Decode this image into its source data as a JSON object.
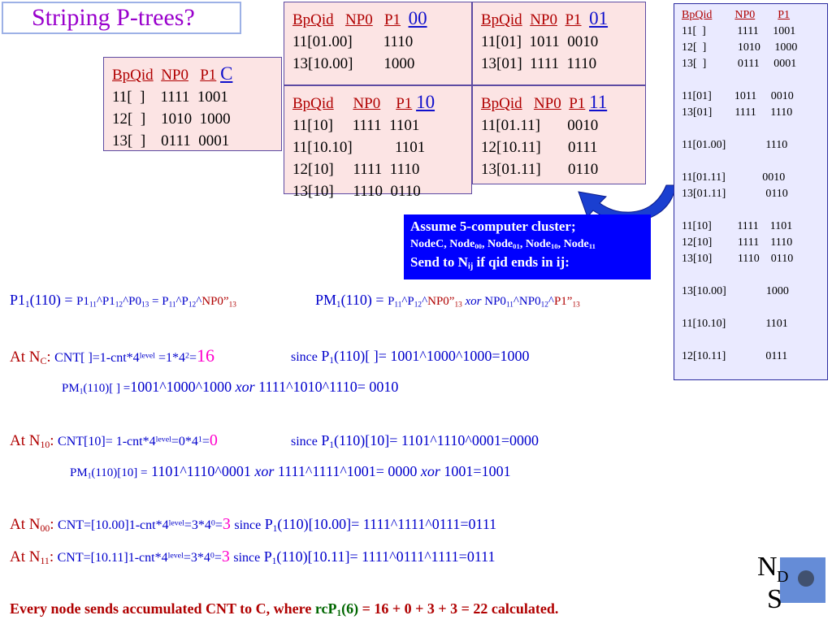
{
  "title": "Striping P-trees?",
  "box_c": {
    "header": [
      "BpQid",
      "NP0",
      "P1",
      "C"
    ],
    "rows": [
      [
        "11[  ]",
        "1111",
        "1001"
      ],
      [
        "12[  ]",
        "1010",
        "1000"
      ],
      [
        "13[  ]",
        "0111",
        "0001"
      ]
    ]
  },
  "box_00": {
    "header": [
      "BpQid",
      "NP0",
      "P1",
      "00"
    ],
    "rows": [
      [
        "11[01.00]",
        "1110"
      ],
      [
        "13[10.00]",
        "1000"
      ]
    ]
  },
  "box_01": {
    "header": [
      "BpQid",
      "NP0",
      "P1",
      "01"
    ],
    "rows": [
      [
        "11[01]",
        "1011",
        "0010"
      ],
      [
        "13[01]",
        "1111",
        "1110"
      ]
    ]
  },
  "box_10": {
    "header": [
      "BpQid",
      "NP0",
      "P1",
      "10"
    ],
    "rows": [
      [
        "11[10]",
        "1111",
        "1101"
      ],
      [
        "11[10.10]",
        "",
        "1101"
      ],
      [
        "12[10]",
        "1111",
        "1110"
      ],
      [
        "13[10]",
        "1110",
        "0110"
      ]
    ]
  },
  "box_11": {
    "header": [
      "BpQid",
      "NP0",
      "P1",
      "11"
    ],
    "rows": [
      [
        "11[01.11]",
        "0010"
      ],
      [
        "12[10.11]",
        "0111"
      ],
      [
        "13[01.11]",
        "0110"
      ]
    ]
  },
  "right_panel": {
    "header": [
      "BpQid",
      "NP0",
      "P1"
    ],
    "rows": [
      [
        "11[  ]",
        "1111",
        "1001"
      ],
      [
        "12[  ]",
        "1010",
        "1000"
      ],
      [
        "13[  ]",
        "0111",
        "0001"
      ],
      [
        "11[01]",
        "1011",
        "0010"
      ],
      [
        "13[01]",
        "1111",
        "1110"
      ],
      [
        "11[01.00]",
        "1110"
      ],
      [
        "11[01.11]",
        "0010"
      ],
      [
        "13[01.11]",
        "0110"
      ],
      [
        "11[10]",
        "1111",
        "1101"
      ],
      [
        "12[10]",
        "1111",
        "1110"
      ],
      [
        "13[10]",
        "1110",
        "0110"
      ],
      [
        "13[10.00]",
        "1000"
      ],
      [
        "11[10.10]",
        "1101"
      ],
      [
        "12[10.11]",
        "0111"
      ]
    ]
  },
  "assume": {
    "line1": "Assume 5-computer cluster;",
    "line2": "NodeC, Node00, Node01, Node10, Node11",
    "line3": "Send to Nij if qid ends in ij:"
  },
  "formula_p1": "P11(110) = P111^P112^P013 = P11^P12^NP0”13",
  "formula_pm1": "PM1(110) = P11^P12^NP0”13 xor NP011^NP012^P1”13",
  "nc": {
    "label": "At NC:",
    "cnt": "CNT[ ]=1-cnt*4level =1*42=16",
    "since": "since P1(110)[ ]= 1001^1000^1000=1000",
    "pm": "PM1(110)[ ] =1001^1000^1000 xor 1111^1010^1110= 0010"
  },
  "n10": {
    "label": "At N10:",
    "cnt": "CNT[10]= 1-cnt*4level=0*41=0",
    "since": "since P1(110)[10]= 1101^1110^0001=0000",
    "pm": "PM1(110)[10] = 1101^1110^0001 xor 1111^1111^1001= 0000 xor 1001=1001"
  },
  "n00": {
    "label": "At N00:",
    "cnt": "CNT=[10.00]1-cnt*4level=3*40=3",
    "since": "since P1(110)[10.00]= 1111^1111^0111=0111"
  },
  "n11": {
    "label": "At N11:",
    "cnt": "CNT=[10.11]1-cnt*4level=3*40=3",
    "since": "since P1(110)[10.11]= 1111^0111^1111=0111"
  },
  "final": "Every node sends accumulated CNT to C, where rcP1(6) = 16 + 0 + 3 + 3 = 22 calculated.",
  "colors": {
    "dark_red": "#b00000",
    "blue": "#0000cc",
    "magenta": "#ff00cc",
    "purple": "#9900cc",
    "box_fill": "#fce4e4",
    "panel_fill": "#eaeaff",
    "assume_fill": "#0000ff"
  },
  "logo_icon": "nds-logo-icon",
  "arrow_icon": "curved-arrow-icon"
}
